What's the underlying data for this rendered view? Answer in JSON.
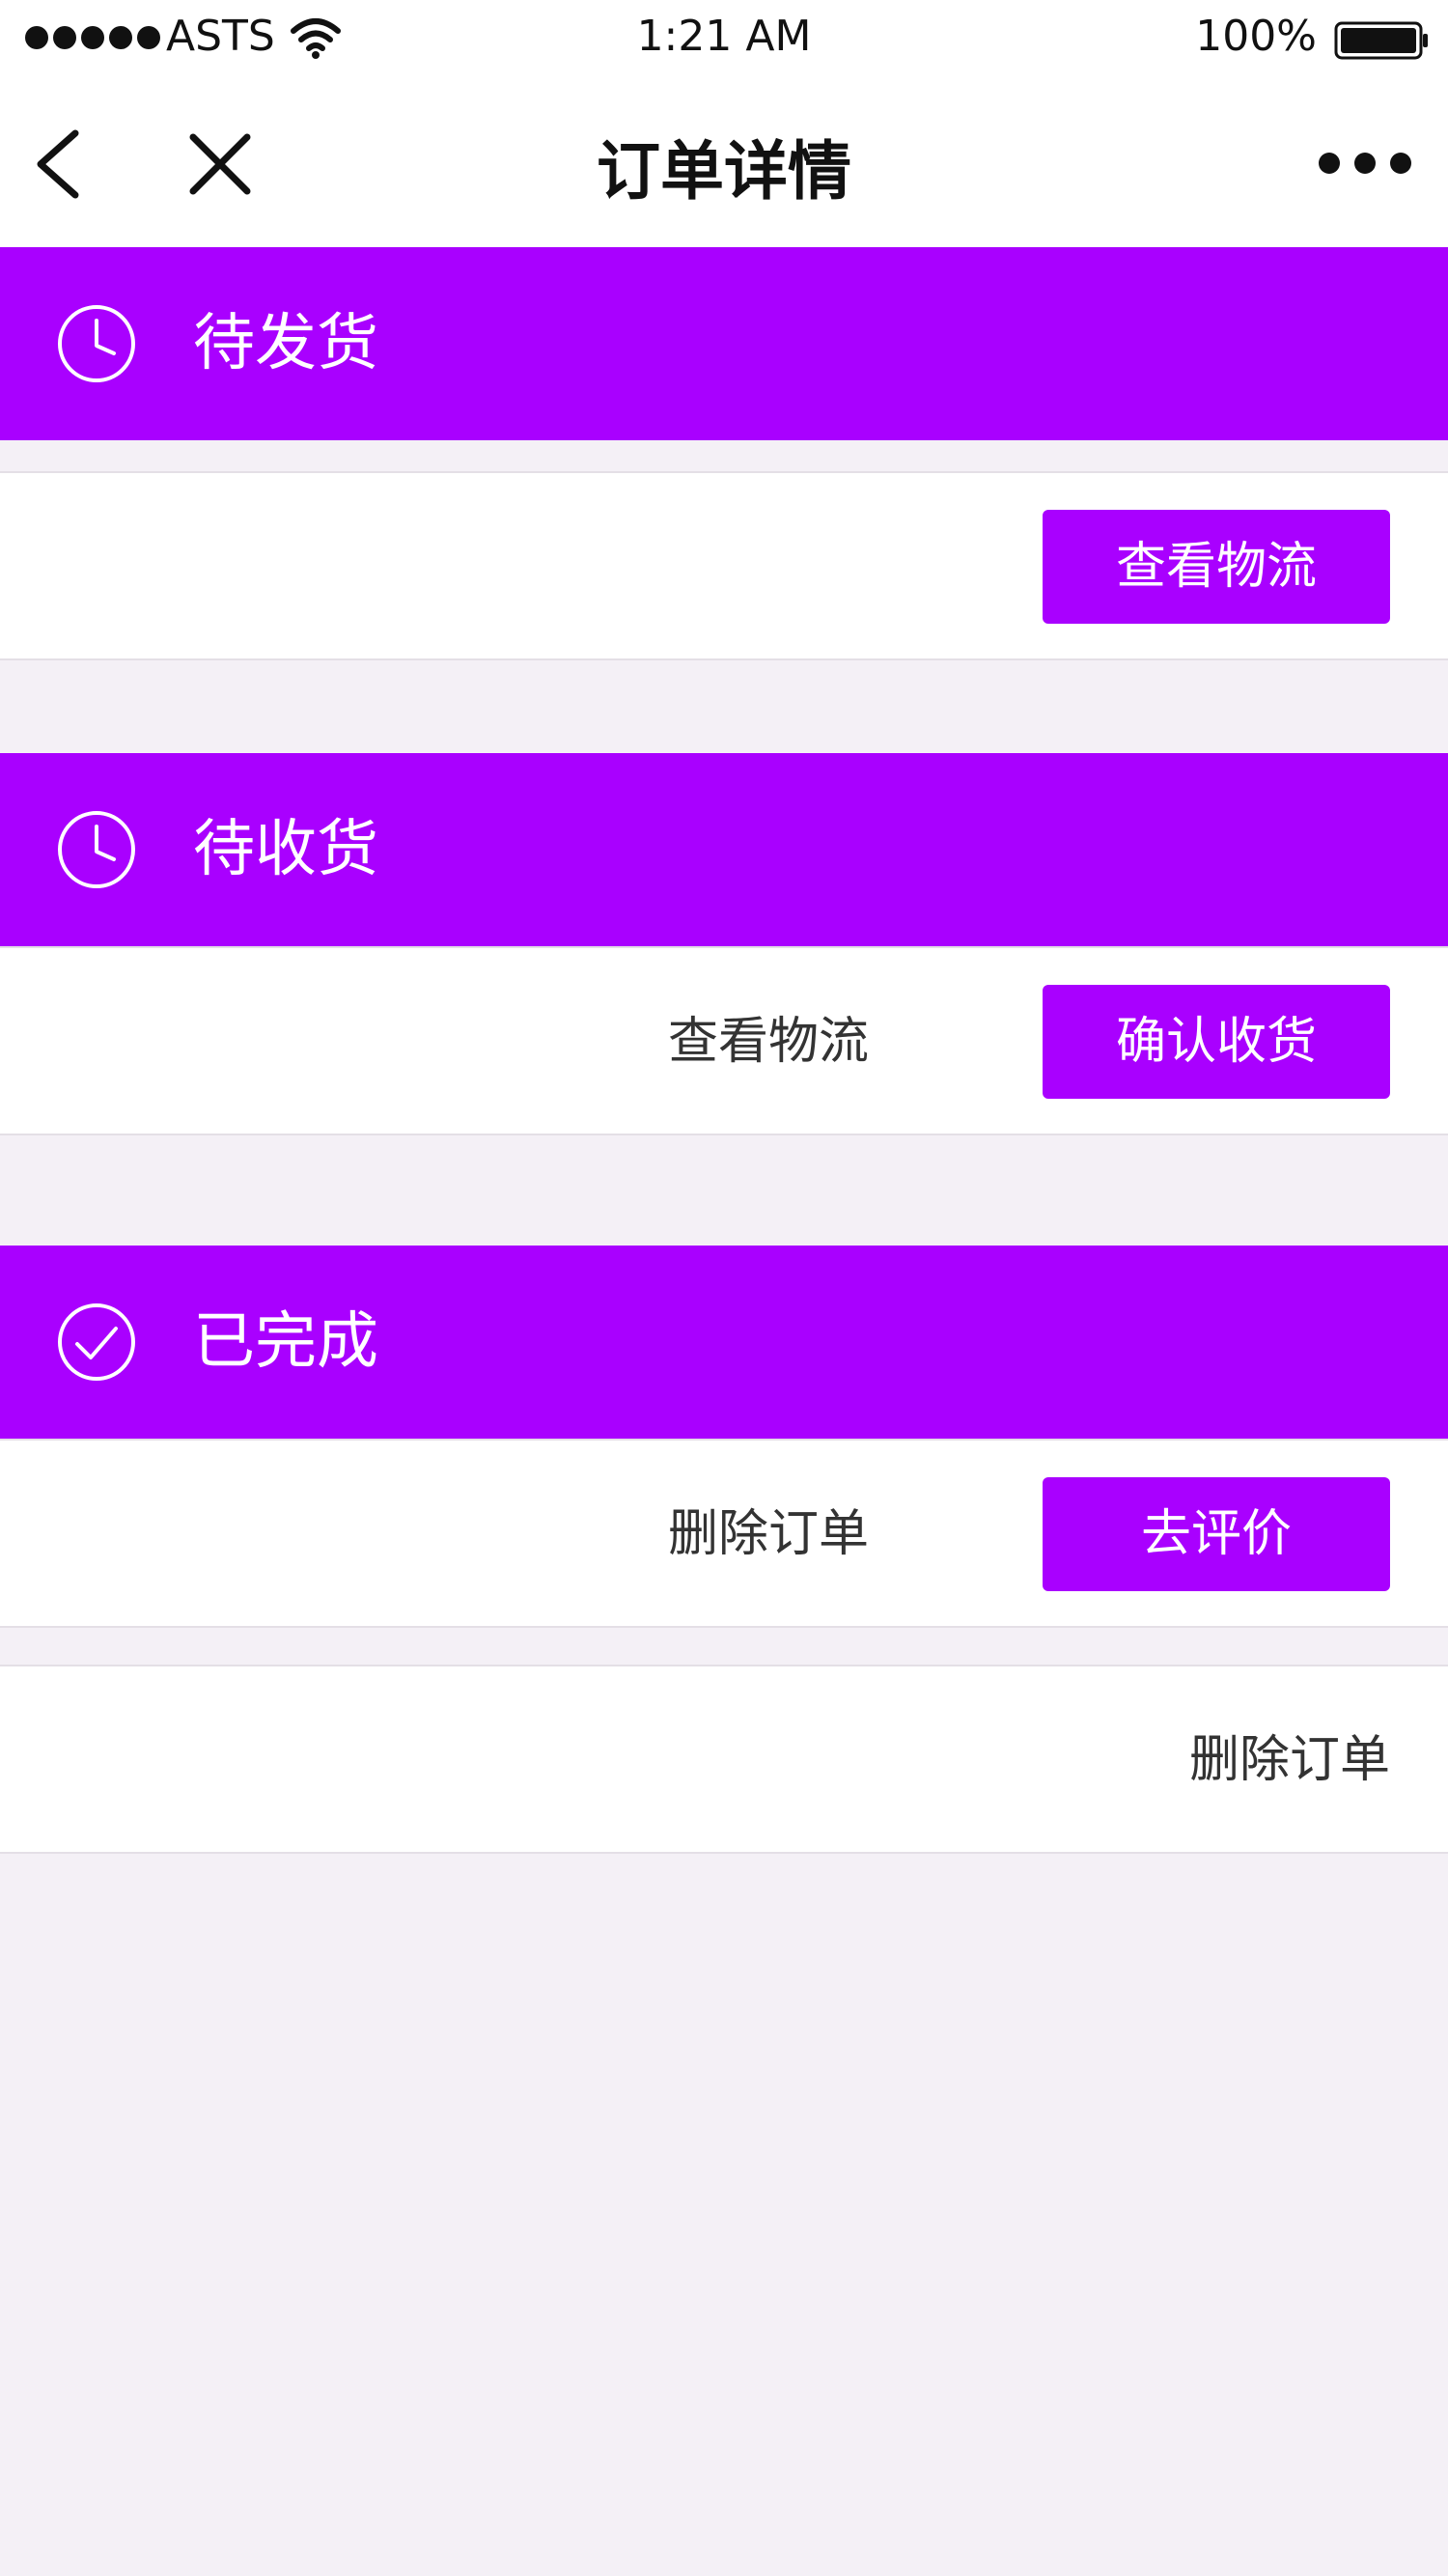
{
  "status_bar": {
    "carrier": "ASTS",
    "time": "1:21 AM",
    "battery": "100%"
  },
  "nav": {
    "title": "订单详情"
  },
  "colors": {
    "accent": "#a900ff",
    "background": "#f4f0f6"
  },
  "orders": [
    {
      "status": "待发货",
      "icon": "clock-icon",
      "primary_action": "查看物流"
    },
    {
      "status": "待收货",
      "icon": "clock-icon",
      "secondary_action": "查看物流",
      "primary_action": "确认收货"
    },
    {
      "status": "已完成",
      "icon": "check-circle-icon",
      "secondary_action": "删除订单",
      "primary_action": "去评价"
    }
  ],
  "extra_row": {
    "action": "删除订单"
  }
}
